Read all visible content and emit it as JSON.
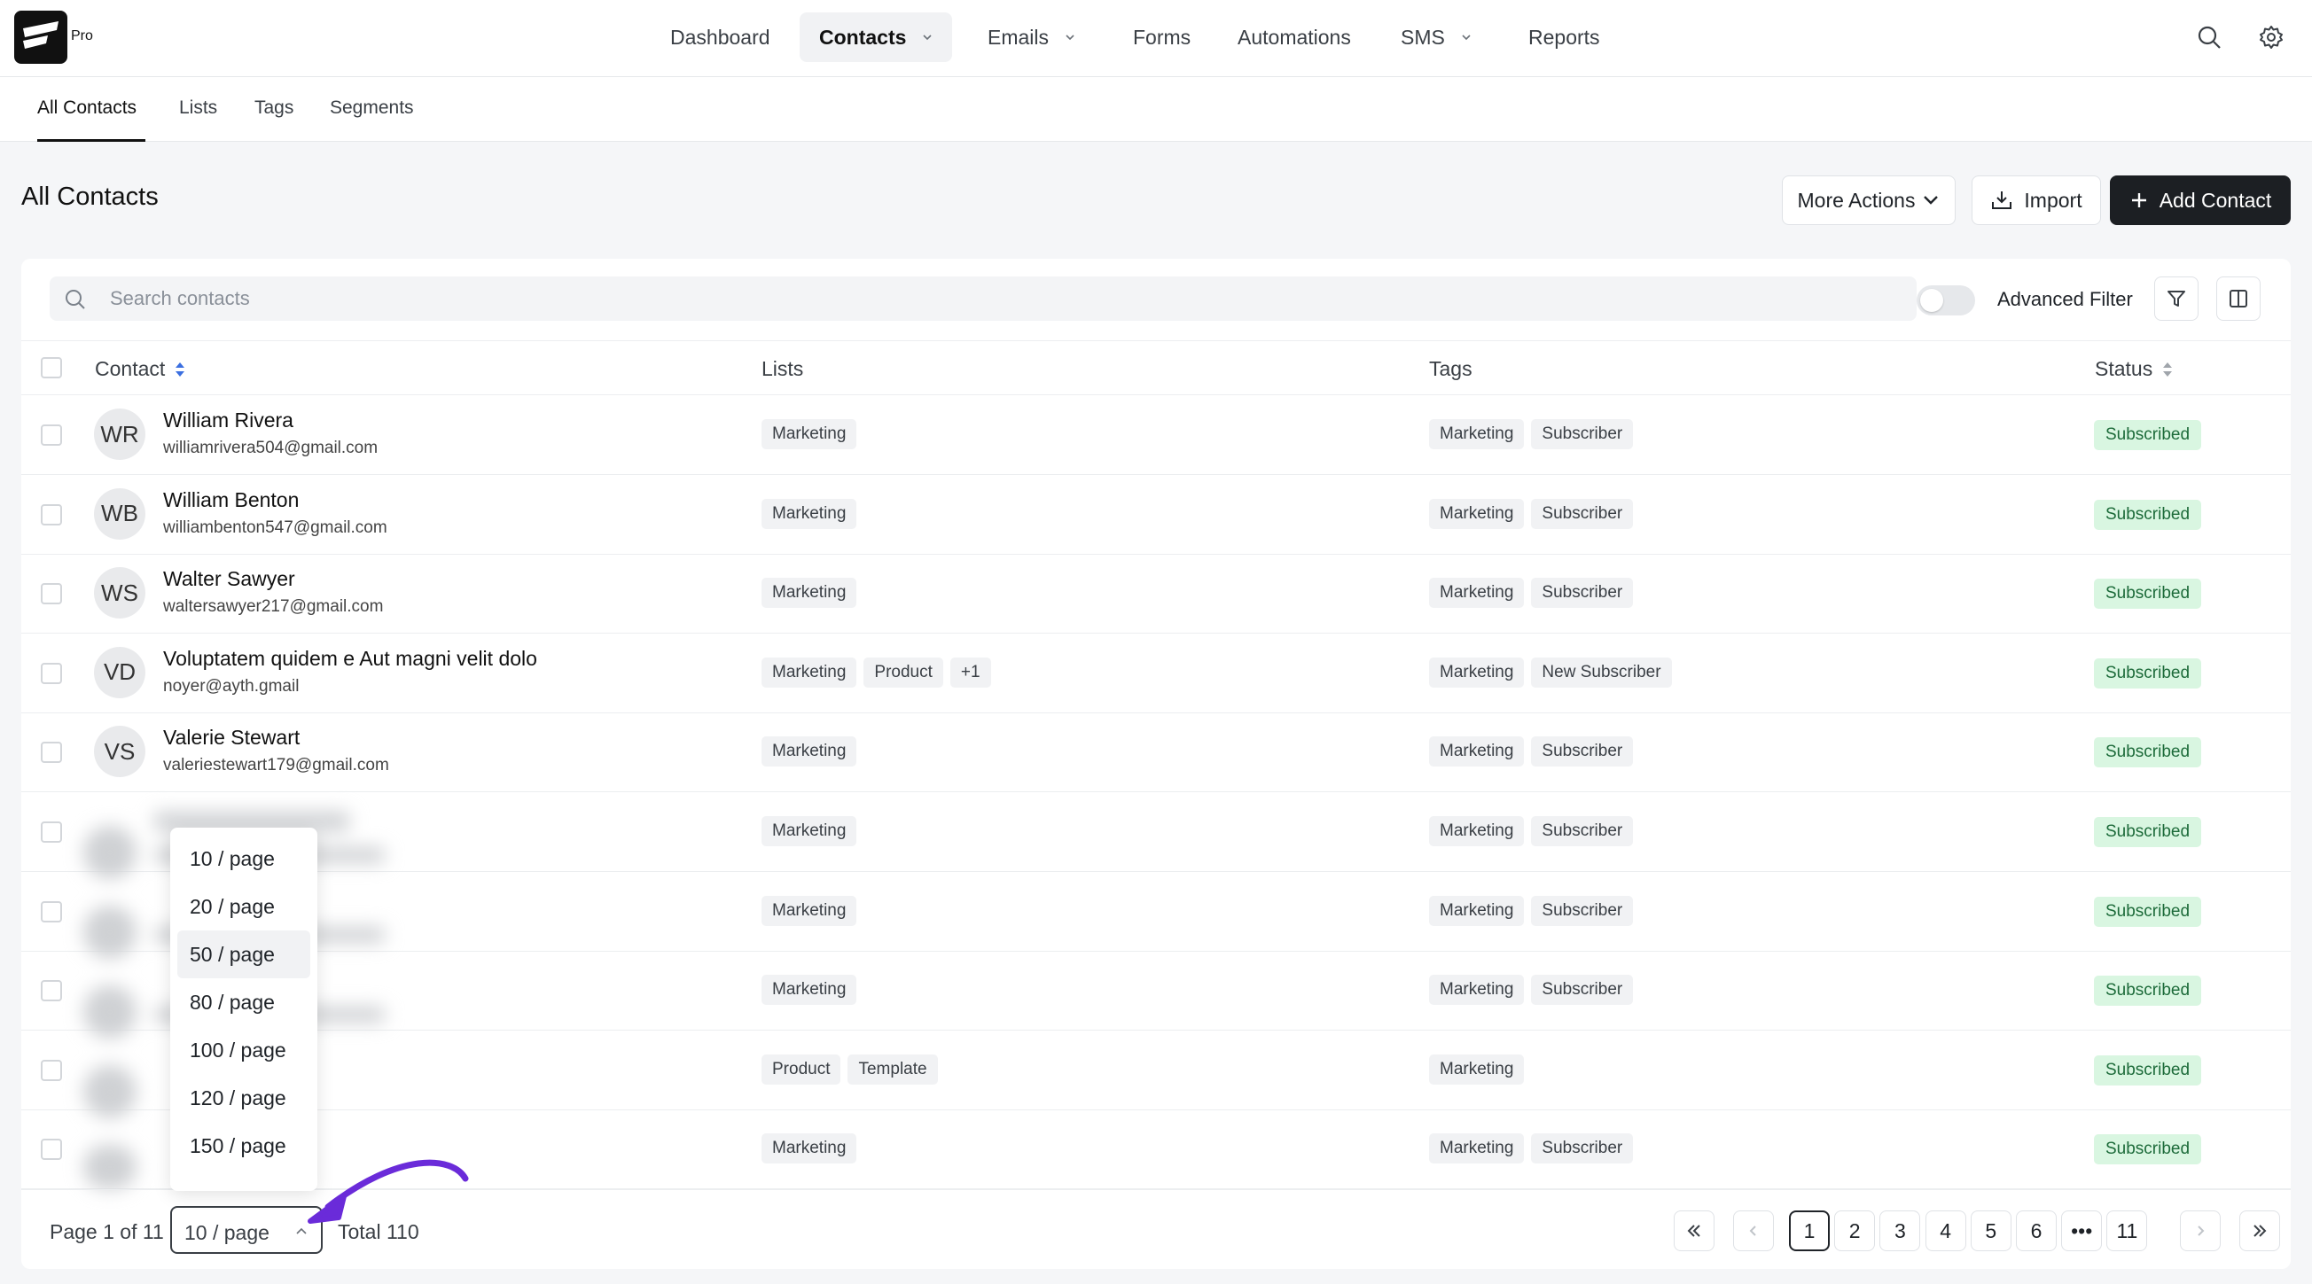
{
  "app": {
    "badge": "Pro"
  },
  "nav": {
    "items": [
      {
        "label": "Dashboard",
        "dropdown": false,
        "active": false
      },
      {
        "label": "Contacts",
        "dropdown": true,
        "active": true
      },
      {
        "label": "Emails",
        "dropdown": true,
        "active": false
      },
      {
        "label": "Forms",
        "dropdown": false,
        "active": false
      },
      {
        "label": "Automations",
        "dropdown": false,
        "active": false
      },
      {
        "label": "SMS",
        "dropdown": true,
        "active": false
      },
      {
        "label": "Reports",
        "dropdown": false,
        "active": false
      }
    ],
    "icons": [
      "search-icon",
      "gear-icon"
    ]
  },
  "subtabs": [
    "All Contacts",
    "Lists",
    "Tags",
    "Segments"
  ],
  "page": {
    "title": "All Contacts",
    "more_actions": "More Actions",
    "import": "Import",
    "add_contact": "Add Contact"
  },
  "filters": {
    "search_placeholder": "Search contacts",
    "advanced_filter": "Advanced Filter",
    "advanced_filter_on": false
  },
  "table": {
    "headers": {
      "contact": "Contact",
      "lists": "Lists",
      "tags": "Tags",
      "status": "Status"
    },
    "rows": [
      {
        "initials": "WR",
        "name": "William Rivera",
        "email": "williamrivera504@gmail.com",
        "lists": [
          "Marketing"
        ],
        "tags": [
          "Marketing",
          "Subscriber"
        ],
        "status": "Subscribed"
      },
      {
        "initials": "WB",
        "name": "William Benton",
        "email": "williambenton547@gmail.com",
        "lists": [
          "Marketing"
        ],
        "tags": [
          "Marketing",
          "Subscriber"
        ],
        "status": "Subscribed"
      },
      {
        "initials": "WS",
        "name": "Walter Sawyer",
        "email": "waltersawyer217@gmail.com",
        "lists": [
          "Marketing"
        ],
        "tags": [
          "Marketing",
          "Subscriber"
        ],
        "status": "Subscribed"
      },
      {
        "initials": "VD",
        "name": "Voluptatem quidem e Aut magni velit dolo",
        "email": "noyer@ayth.gmail",
        "lists": [
          "Marketing",
          "Product",
          "+1"
        ],
        "tags": [
          "Marketing",
          "New Subscriber"
        ],
        "status": "Subscribed"
      },
      {
        "initials": "VS",
        "name": "Valerie Stewart",
        "email": "valeriestewart179@gmail.com",
        "lists": [
          "Marketing"
        ],
        "tags": [
          "Marketing",
          "Subscriber"
        ],
        "status": "Subscribed"
      },
      {
        "initials": "",
        "name": "",
        "email": "",
        "lists": [
          "Marketing"
        ],
        "tags": [
          "Marketing",
          "Subscriber"
        ],
        "status": "Subscribed"
      },
      {
        "initials": "",
        "name": "",
        "email": "",
        "lists": [
          "Marketing"
        ],
        "tags": [
          "Marketing",
          "Subscriber"
        ],
        "status": "Subscribed"
      },
      {
        "initials": "",
        "name": "",
        "email": "",
        "lists": [
          "Marketing"
        ],
        "tags": [
          "Marketing",
          "Subscriber"
        ],
        "status": "Subscribed"
      },
      {
        "initials": "",
        "name": "",
        "email": "",
        "lists": [
          "Product",
          "Template"
        ],
        "tags": [
          "Marketing"
        ],
        "status": "Subscribed"
      },
      {
        "initials": "",
        "name": "",
        "email": "",
        "lists": [
          "Marketing"
        ],
        "tags": [
          "Marketing",
          "Subscriber"
        ],
        "status": "Subscribed"
      }
    ]
  },
  "page_size_dropdown": {
    "options": [
      "10 / page",
      "20 / page",
      "50 / page",
      "80 / page",
      "100 / page",
      "120 / page",
      "150 / page"
    ],
    "hovered": "50 / page"
  },
  "pagination": {
    "page_info": "Page 1 of 11",
    "page_size": "10 / page",
    "total": "Total 110",
    "pages": [
      "1",
      "2",
      "3",
      "4",
      "5",
      "6",
      "•••",
      "11"
    ],
    "current": "1"
  },
  "colors": {
    "primary_button": "#1c1f23",
    "status_bg": "#d9f6e1",
    "status_text": "#1d6b3a",
    "annotation_arrow": "#6a2bd9",
    "sort_active": "#3b6fe0"
  }
}
